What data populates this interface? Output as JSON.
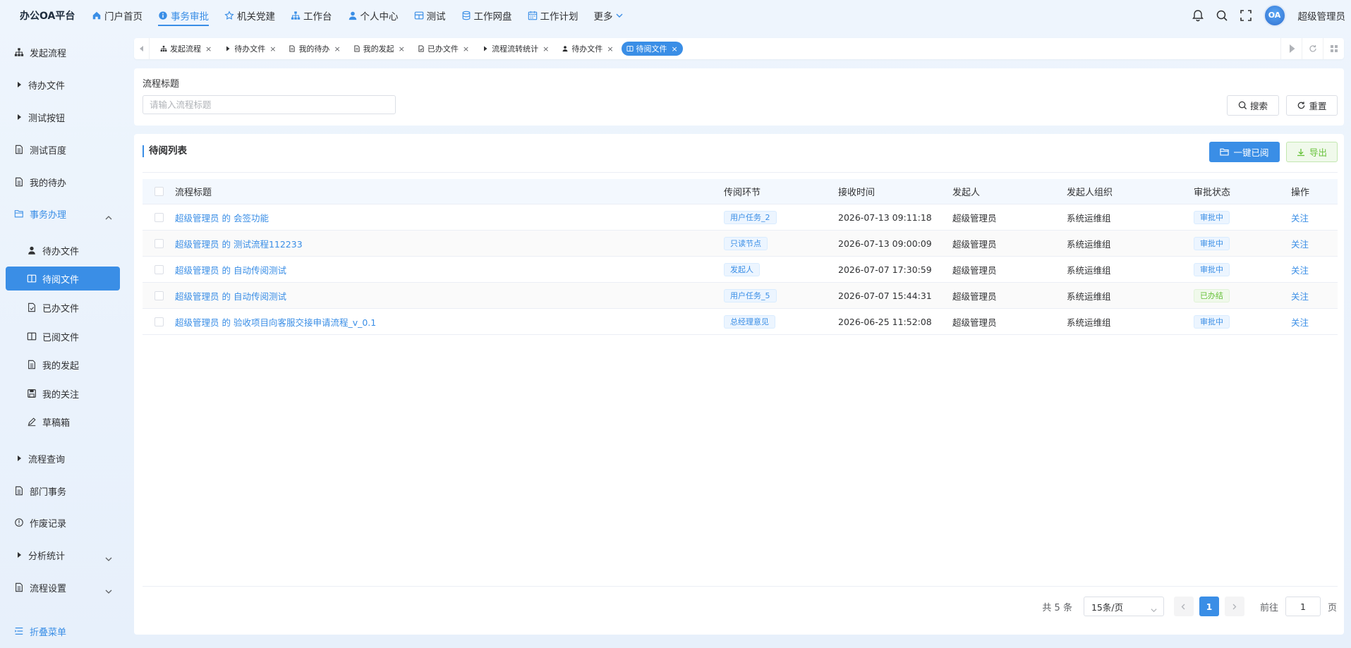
{
  "brand": "办公OA平台",
  "topnav": [
    {
      "label": "门户首页",
      "icon": "home-icon"
    },
    {
      "label": "事务审批",
      "icon": "info-icon",
      "active": true
    },
    {
      "label": "机关党建",
      "icon": "star-icon"
    },
    {
      "label": "工作台",
      "icon": "sitemap-icon"
    },
    {
      "label": "个人中心",
      "icon": "user-icon"
    },
    {
      "label": "测试",
      "icon": "grid-icon"
    },
    {
      "label": "工作网盘",
      "icon": "database-icon"
    },
    {
      "label": "工作计划",
      "icon": "calendar-icon"
    }
  ],
  "more_label": "更多",
  "avatar_text": "OA",
  "username": "超级管理员",
  "sidebar": {
    "items": [
      {
        "label": "发起流程",
        "icon": "sitemap-icon"
      },
      {
        "label": "待办文件",
        "icon": "caret-right-icon"
      },
      {
        "label": "测试按钮",
        "icon": "caret-right-icon"
      },
      {
        "label": "测试百度",
        "icon": "document-icon"
      },
      {
        "label": "我的待办",
        "icon": "document-icon"
      },
      {
        "label": "事务办理",
        "icon": "folder-open-icon"
      },
      {
        "label": "待办文件",
        "icon": "user-icon"
      },
      {
        "label": "待阅文件",
        "icon": "book-icon"
      },
      {
        "label": "已办文件",
        "icon": "document-check-icon"
      },
      {
        "label": "已阅文件",
        "icon": "book-icon"
      },
      {
        "label": "我的发起",
        "icon": "document-icon"
      },
      {
        "label": "我的关注",
        "icon": "save-icon"
      },
      {
        "label": "草稿箱",
        "icon": "pen-icon"
      },
      {
        "label": "流程查询",
        "icon": "caret-right-icon"
      },
      {
        "label": "部门事务",
        "icon": "document-icon"
      },
      {
        "label": "作废记录",
        "icon": "info-icon"
      },
      {
        "label": "分析统计",
        "icon": "caret-right-icon"
      },
      {
        "label": "流程设置",
        "icon": "document-icon"
      }
    ],
    "collapse_label": "折叠菜单"
  },
  "tabs": [
    {
      "label": "发起流程",
      "icon": "sitemap-icon"
    },
    {
      "label": "待办文件",
      "icon": "caret-right-icon"
    },
    {
      "label": "我的待办",
      "icon": "document-icon"
    },
    {
      "label": "我的发起",
      "icon": "document-icon"
    },
    {
      "label": "已办文件",
      "icon": "document-check-icon"
    },
    {
      "label": "流程流转统计",
      "icon": "caret-right-icon"
    },
    {
      "label": "待办文件",
      "icon": "user-icon"
    },
    {
      "label": "待阅文件",
      "icon": "book-icon",
      "active": true
    }
  ],
  "tab_close": "×",
  "search": {
    "label": "流程标题",
    "placeholder": "请输入流程标题",
    "search_btn": "搜索",
    "reset_btn": "重置"
  },
  "list": {
    "title": "待阅列表",
    "read_all_btn": "一键已阅",
    "export_btn": "导出",
    "columns": [
      "流程标题",
      "传阅环节",
      "接收时间",
      "发起人",
      "发起人组织",
      "审批状态",
      "操作"
    ],
    "rows": [
      {
        "title": "超级管理员 的 会签功能",
        "node": "用户任务_2",
        "time": "2026-07-13 09:11:18",
        "user": "超级管理员",
        "org": "系统运维组",
        "status": "审批中",
        "status_color": "blue",
        "op": "关注"
      },
      {
        "title": "超级管理员 的 测试流程112233",
        "node": "只读节点",
        "time": "2026-07-13 09:00:09",
        "user": "超级管理员",
        "org": "系统运维组",
        "status": "审批中",
        "status_color": "blue",
        "op": "关注"
      },
      {
        "title": "超级管理员 的 自动传阅测试",
        "node": "发起人",
        "time": "2026-07-07 17:30:59",
        "user": "超级管理员",
        "org": "系统运维组",
        "status": "审批中",
        "status_color": "blue",
        "op": "关注"
      },
      {
        "title": "超级管理员 的 自动传阅测试",
        "node": "用户任务_5",
        "time": "2026-07-07 15:44:31",
        "user": "超级管理员",
        "org": "系统运维组",
        "status": "已办结",
        "status_color": "green",
        "op": "关注"
      },
      {
        "title": "超级管理员 的 验收项目向客服交接申请流程_v_0.1",
        "node": "总经理意见",
        "time": "2026-06-25 11:52:08",
        "user": "超级管理员",
        "org": "系统运维组",
        "status": "审批中",
        "status_color": "blue",
        "op": "关注"
      }
    ]
  },
  "pagination": {
    "total": "共 5 条",
    "page_size": "15条/页",
    "current_page": "1",
    "goto_prefix": "前往",
    "goto_value": "1",
    "goto_suffix": "页"
  },
  "colors": {
    "accent": "#3a8ee6",
    "success": "#67c23a"
  }
}
